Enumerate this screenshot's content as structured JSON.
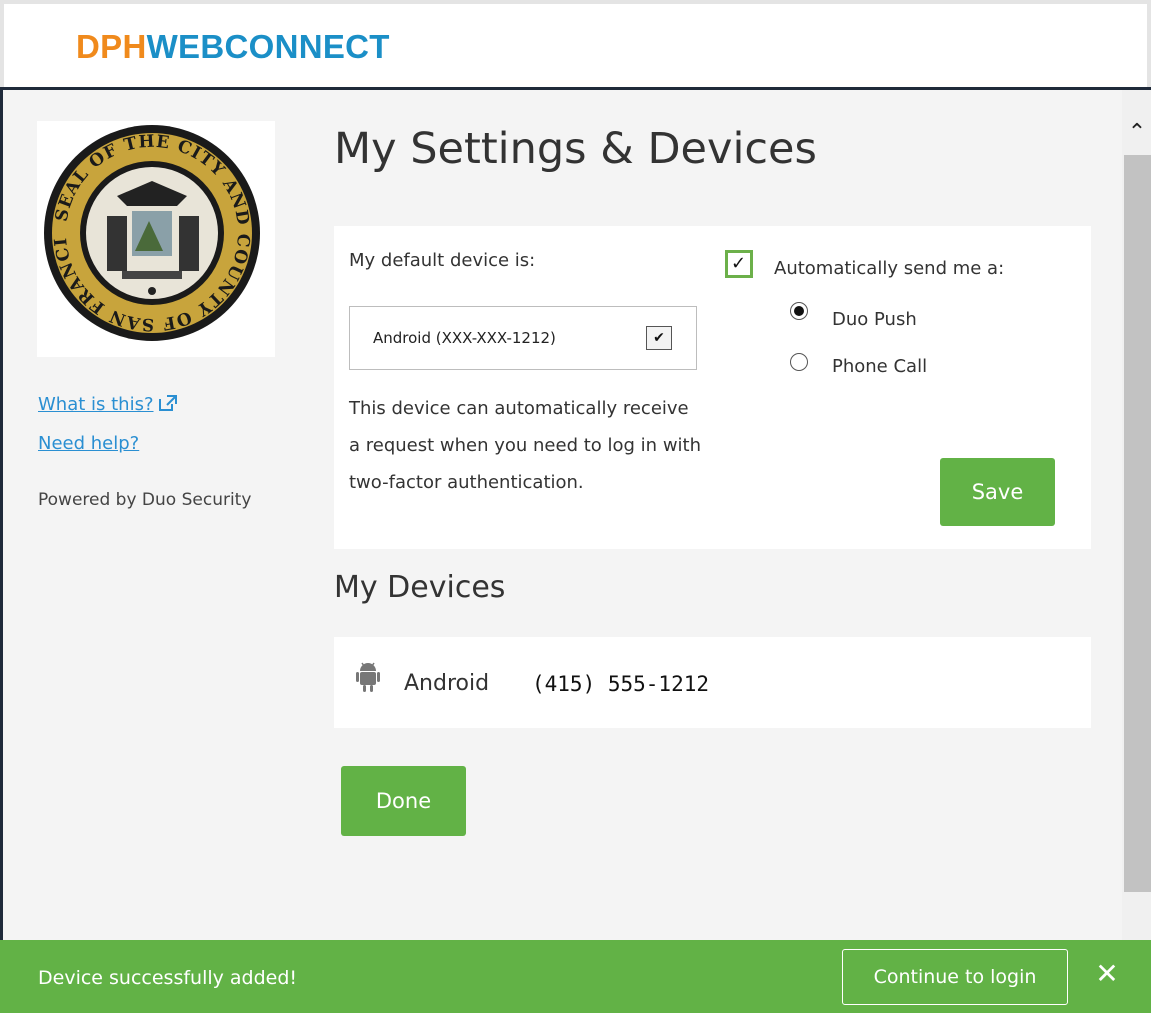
{
  "header": {
    "brand_part1": "DPH",
    "brand_part2": "WEBCONNECT"
  },
  "sidebar": {
    "logo_text": "SEAL OF THE CITY AND COUNTY OF SAN FRANCISCO",
    "what_is_this": "What is this?",
    "need_help": "Need help?",
    "powered_by": "Powered by Duo Security"
  },
  "settings": {
    "title": "My Settings & Devices",
    "default_device_label": "My default device is:",
    "default_device_value": "Android (XXX-XXX-1212)",
    "description": "This device can automatically receive a request when you need to log in with two-factor authentication.",
    "auto_send_label": "Automatically send me a:",
    "auto_send_checked": true,
    "options": [
      {
        "label": "Duo Push",
        "selected": true
      },
      {
        "label": "Phone Call",
        "selected": false
      }
    ],
    "save_label": "Save"
  },
  "devices": {
    "title": "My Devices",
    "items": [
      {
        "type": "Android",
        "number": "(415) 555-1212",
        "icon": "android-icon"
      }
    ]
  },
  "done_label": "Done",
  "banner": {
    "message": "Device successfully added!",
    "continue_label": "Continue to login",
    "close_icon": "close-icon"
  },
  "colors": {
    "accent_green": "#62b246",
    "brand_orange": "#f08a1c",
    "brand_blue": "#1b8fc7",
    "link_blue": "#2a8fd2"
  }
}
